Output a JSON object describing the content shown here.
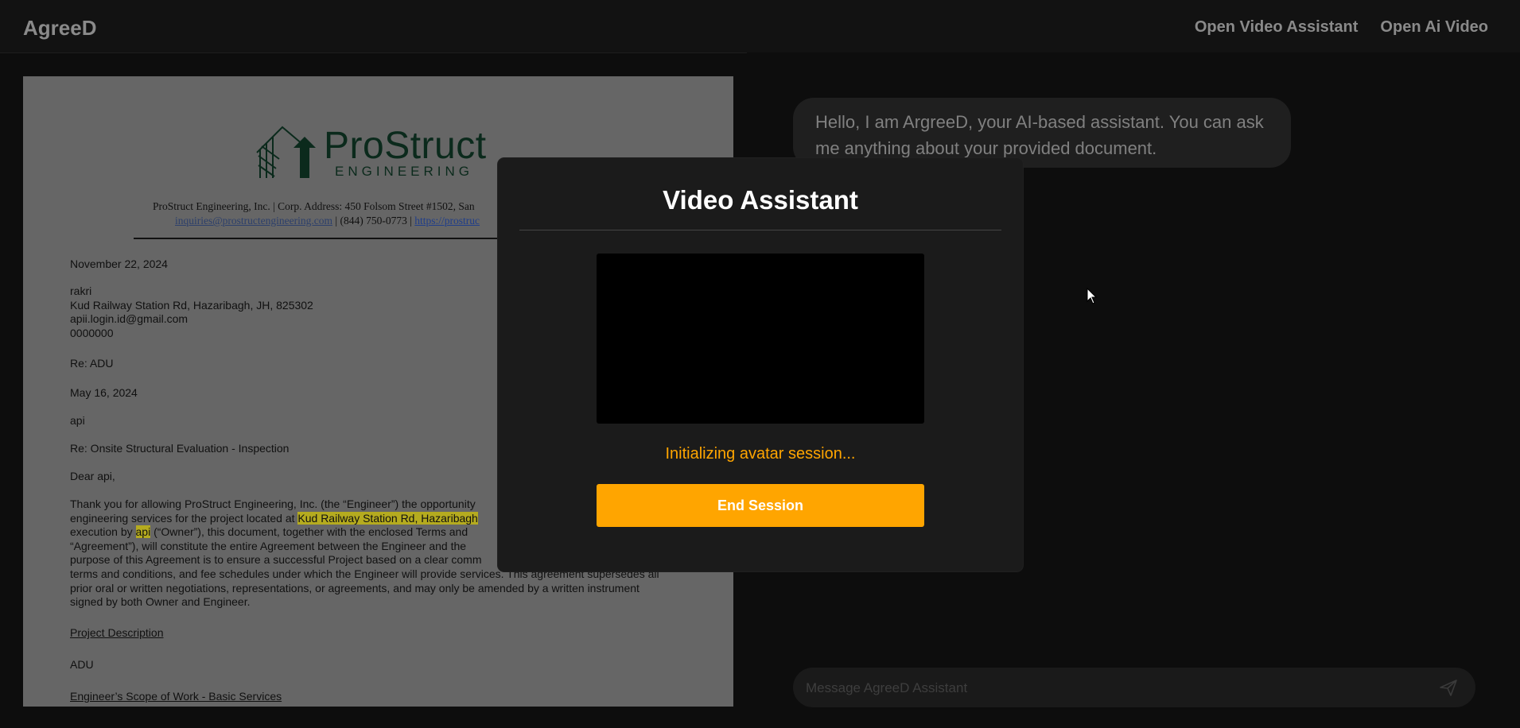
{
  "header": {
    "brand": "AgreeD",
    "nav": [
      "Open Video Assistant",
      "Open Ai Video"
    ]
  },
  "document": {
    "logo": {
      "name": "ProStruct",
      "sub": "ENGINEERING"
    },
    "corp_line": "ProStruct Engineering, Inc. | Corp. Address: 450 Folsom Street #1502, San",
    "contact": {
      "email": "inquiries@prostructengineering.com",
      "phone": " | (844) 750-0773 | ",
      "site": "https://prostruc"
    },
    "date": "November 22, 2024",
    "recipient": [
      "rakri",
      "Kud Railway Station Rd, Hazaribagh, JH, 825302",
      "apii.login.id@gmail.com",
      "0000000"
    ],
    "re_1": "Re: ADU",
    "date_2": "May 16, 2024",
    "name": "api",
    "re_2": "Re: Onsite Structural Evaluation - Inspection",
    "salutation": "Dear api,",
    "body": {
      "p1": "Thank you for allowing ProStruct Engineering, Inc. (the “Engineer”) the opportunity",
      "p2": "engineering services for the project located at ",
      "p2_hl": "Kud Railway Station Rd, Hazaribagh",
      "p3_a": "execution by ",
      "p3_hl": "api",
      "p3_b": " (“Owner”), this document, together with the enclosed Terms and",
      "p4": "“Agreement”), will constitute the entire Agreement between the Engineer and the",
      "p5": "purpose of this Agreement is to ensure a successful Project based on a clear comm",
      "p6": "terms and conditions, and fee schedules under which the Engineer will provide services. This agreement supersedes all",
      "p7": "prior oral or written negotiations, representations, or agreements, and may only be amended by a written instrument",
      "p8": "signed by both Owner and Engineer."
    },
    "section_1": "Project Description",
    "project": "ADU",
    "section_2": "Engineer’s Scope of Work - Basic Services"
  },
  "chat": {
    "greeting": "Hello, I am ArgreeD, your AI-based assistant. You can ask me anything about your provided document.",
    "placeholder": "Message AgreeD Assistant"
  },
  "modal": {
    "title": "Video Assistant",
    "status": "Initializing avatar session...",
    "end_label": "End Session"
  },
  "colors": {
    "accent": "#ffa500",
    "highlight": "#b5ab1f"
  }
}
